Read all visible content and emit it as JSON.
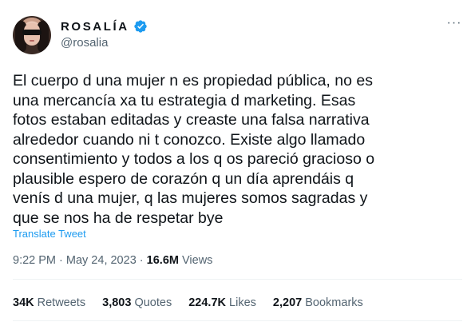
{
  "author": {
    "display_name": "ROSALÍA",
    "handle": "@rosalia",
    "verified": true,
    "verified_color": "#1d9bf0"
  },
  "menu": {
    "more_icon": "more-horizontal-icon",
    "label": "···"
  },
  "tweet": {
    "text": "El cuerpo d una mujer n es propiedad pública, no es\nuna mercancía xa tu estrategia d marketing. Esas\nfotos estaban editadas y creaste una falsa narrativa\nalrededor cuando ni t conozco. Existe algo llamado\nconsentimiento y todos a los q os pareció gracioso o\nplausible espero de corazón q un día aprendáis q\nvenís d una mujer, q las mujeres somos sagradas y\nque se nos ha de respetar bye",
    "translate_label": "Translate Tweet"
  },
  "meta": {
    "time": "9:22 PM",
    "separator": " · ",
    "date": "May 24, 2023",
    "views_count": "16.6M",
    "views_label": "Views"
  },
  "stats": {
    "retweets": {
      "count": "34K",
      "label": "Retweets"
    },
    "quotes": {
      "count": "3,803",
      "label": "Quotes"
    },
    "likes": {
      "count": "224.7K",
      "label": "Likes"
    },
    "bookmarks": {
      "count": "2,207",
      "label": "Bookmarks"
    }
  },
  "colors": {
    "link": "#1d9bf0",
    "secondary_text": "#536471",
    "primary_text": "#0f1419"
  }
}
